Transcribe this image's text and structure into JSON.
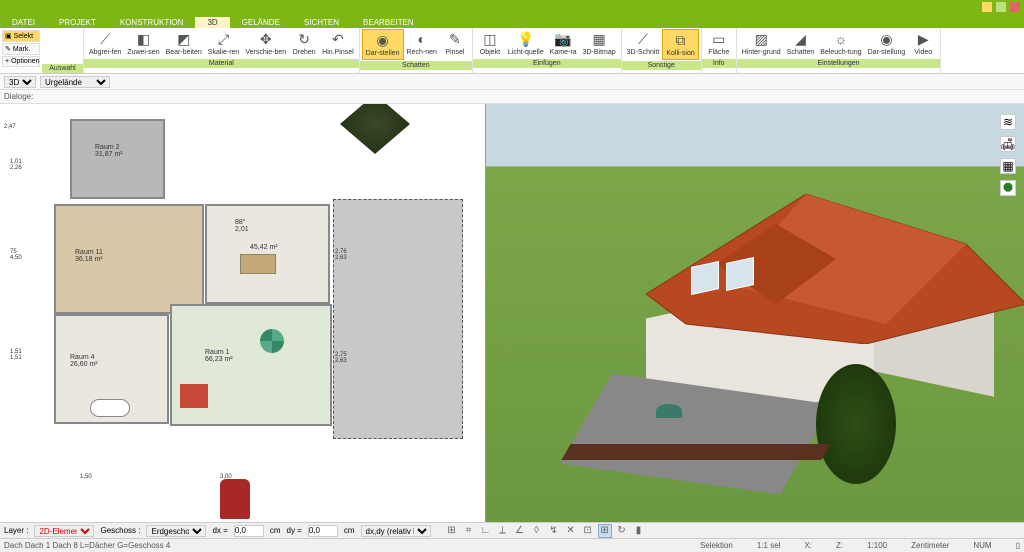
{
  "tabs": {
    "datei": "DATEI",
    "projekt": "PROJEKT",
    "konstruktion": "KONSTRUKTION",
    "dreid": "3D",
    "gelaende": "GELÄNDE",
    "sichten": "SICHTEN",
    "bearbeiten": "BEARBEITEN"
  },
  "quick": {
    "selekt": "Selekt",
    "mark": "Mark.",
    "optionen": "Optionen"
  },
  "ribbon": {
    "auswahl": "Auswahl",
    "material": "Material",
    "schatten": "Schatten",
    "einfuegen": "Einfügen",
    "sonstige": "Sonstige",
    "info": "Info",
    "einstellungen": "Einstellungen",
    "abgreifen": "Abgrei-fen",
    "zuweisen": "Zuwei-sen",
    "bearbeiten": "Bear-beiten",
    "skalieren": "Skalie-ren",
    "verschieben": "Verschie-ben",
    "drehen": "Drehen",
    "hinpinsel": "Hin.Pinsel",
    "darstellen": "Dar-stellen",
    "rechnen": "Rech-nen",
    "pinsel": "Pinsel",
    "objekt": "Objekt",
    "lichtquelle": "Licht-quelle",
    "kamera": "Kame-ra",
    "dreidbitmap": "3D-Bitmap",
    "dreidschnitt": "3D-Schnitt",
    "kollision": "Kolli-sion",
    "flaeche": "Fläche",
    "hintergrund": "Hinter-grund",
    "schatten2": "Schatten",
    "beleuchtung": "Beleuch-tung",
    "darstellung": "Dar-stellung",
    "video": "Video"
  },
  "subbar": {
    "mode": "3D",
    "view": "Urgelände",
    "dialoge": "Dialoge:"
  },
  "rooms": {
    "r2": {
      "name": "Raum 2",
      "area": "31,87 m²"
    },
    "r11": {
      "name": "Raum 11",
      "area": "36,18 m²"
    },
    "r1": {
      "name": "Raum 1",
      "area": "66,23 m²"
    },
    "r4": {
      "name": "Raum 4",
      "area": "26,60 m²"
    },
    "angle": "88°",
    "a401": "45,42 m²"
  },
  "dims": {
    "d1": "1,01",
    "d2": "2,26",
    "d3": "75",
    "d4": "4,50",
    "d5": "1,51",
    "d6": "1,51",
    "d7": "2,47",
    "d8": "1,50",
    "d9": "2,01",
    "d10": "2,76",
    "d11": "2,63",
    "d12": "2,75",
    "d13": "2,63",
    "d14": "3,00"
  },
  "propbar": {
    "layer": "Layer :",
    "layer_val": "2D-Elemen",
    "geschoss": "Geschoss :",
    "geschoss_val": "Erdgeschos",
    "dx": "dx =",
    "dx_val": "0,0",
    "dy": "dy =",
    "dy_val": "0,0",
    "cm": "cm",
    "rel": "dx,dy (relativ ka"
  },
  "status": {
    "path": "Dach Dach 1 Dach 8 L=Dächer G=Geschoss 4",
    "selektion": "Selektion",
    "sel_val": "1:1 sel",
    "x": "X:",
    "z": "Z:",
    "scale": "1:100",
    "unit": "Zentimeter",
    "num": "NUM"
  }
}
